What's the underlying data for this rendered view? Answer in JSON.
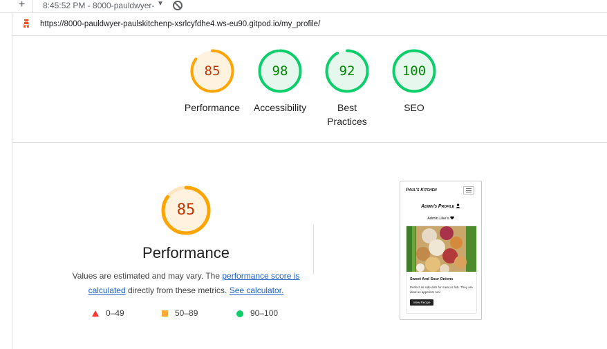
{
  "browser": {
    "new_tab_symbol": "+",
    "tab_title": "8:45:52 PM - 8000-pauldwyer-",
    "url": "https://8000-pauldwyer-paulskitchenp-xsrlcyfdhe4.ws-eu90.gitpod.io/my_profile/"
  },
  "summary_scores": [
    {
      "label": "Performance",
      "score": "85",
      "value": 85,
      "color": "#ffa400",
      "text_color": "#c33300",
      "bg": "#fff3e0"
    },
    {
      "label": "Accessibility",
      "score": "98",
      "value": 98,
      "color": "#0cce6b",
      "text_color": "#008800",
      "bg": "#e6f8ee"
    },
    {
      "label": "Best Practices",
      "score": "92",
      "value": 92,
      "color": "#0cce6b",
      "text_color": "#008800",
      "bg": "#e6f8ee"
    },
    {
      "label": "SEO",
      "score": "100",
      "value": 100,
      "color": "#0cce6b",
      "text_color": "#008800",
      "bg": "#e6f8ee"
    }
  ],
  "performance": {
    "score": "85",
    "value": 85,
    "title": "Performance",
    "desc_part1": "Values are estimated and may vary. The ",
    "link1": "performance score is calculated",
    "desc_part2": " directly from these metrics. ",
    "link2": "See calculator."
  },
  "legend": {
    "fail": "0–49",
    "average": "50–89",
    "pass": "90–100"
  },
  "screenshot": {
    "brand": "Paul's Kitchen",
    "heading": "Admin's Profile",
    "likes": "Admin Like's",
    "card_title": "Sweet And Sour Onions",
    "card_text": "Perfect as side dish for meat or fish. They are ideal as appetizer too!",
    "button": "View Recipe"
  },
  "icons": {
    "add_tab": "plus-icon",
    "dropdown": "caret-down-icon",
    "blocked": "block-icon",
    "lighthouse": "lighthouse-icon",
    "user": "user-icon",
    "heart": "heart-icon",
    "menu": "hamburger-icon"
  }
}
